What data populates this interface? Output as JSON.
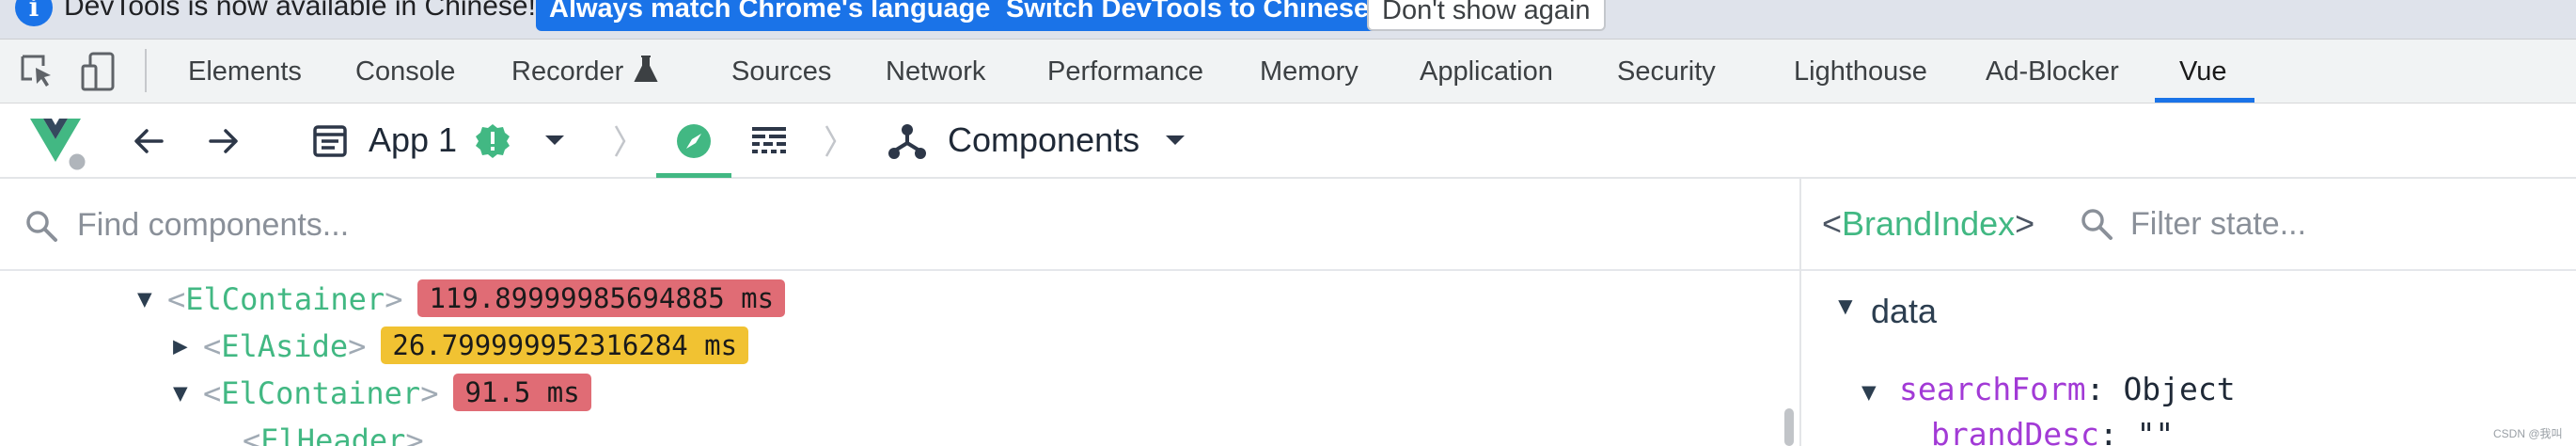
{
  "infobar": {
    "message": "DevTools is now available in Chinese!",
    "match_language_label": "Always match Chrome's language",
    "switch_label": "Switch DevTools to Chinese",
    "dismiss_label": "Don't show again"
  },
  "devtools_tabs": [
    {
      "label": "Elements"
    },
    {
      "label": "Console"
    },
    {
      "label": "Recorder"
    },
    {
      "label": "Sources"
    },
    {
      "label": "Network"
    },
    {
      "label": "Performance"
    },
    {
      "label": "Memory"
    },
    {
      "label": "Application"
    },
    {
      "label": "Security"
    },
    {
      "label": "Lighthouse"
    },
    {
      "label": "Ad-Blocker"
    },
    {
      "label": "Vue",
      "active": true
    }
  ],
  "vue_toolbar": {
    "app_label": "App 1",
    "view_label": "Components"
  },
  "components": {
    "search_placeholder": "Find components...",
    "tree": [
      {
        "name": "ElContainer",
        "expanded": true,
        "time": "119.89999985694885 ms",
        "badge_color": "#e06c75"
      },
      {
        "name": "ElAside",
        "expanded": false,
        "time": "26.799999952316284 ms",
        "badge_color": "#f1c232"
      },
      {
        "name": "ElContainer",
        "expanded": true,
        "time": "91.5 ms",
        "badge_color": "#e06c75"
      },
      {
        "name": "ElHeader",
        "expanded": false,
        "time": ""
      }
    ]
  },
  "inspector": {
    "component_name": "BrandIndex",
    "open_bracket": "<",
    "close_bracket": ">",
    "filter_placeholder": "Filter state...",
    "section_label": "data",
    "state": [
      {
        "key": "searchForm",
        "value": "Object"
      },
      {
        "key": "brandDesc",
        "value": "\"\""
      }
    ]
  },
  "watermark": "CSDN @我叫",
  "colors": {
    "vue_green": "#42b883",
    "chrome_blue": "#1a73e8",
    "badge_red": "#e06c75",
    "badge_yellow": "#f1c232",
    "state_key": "#a23ad6"
  }
}
